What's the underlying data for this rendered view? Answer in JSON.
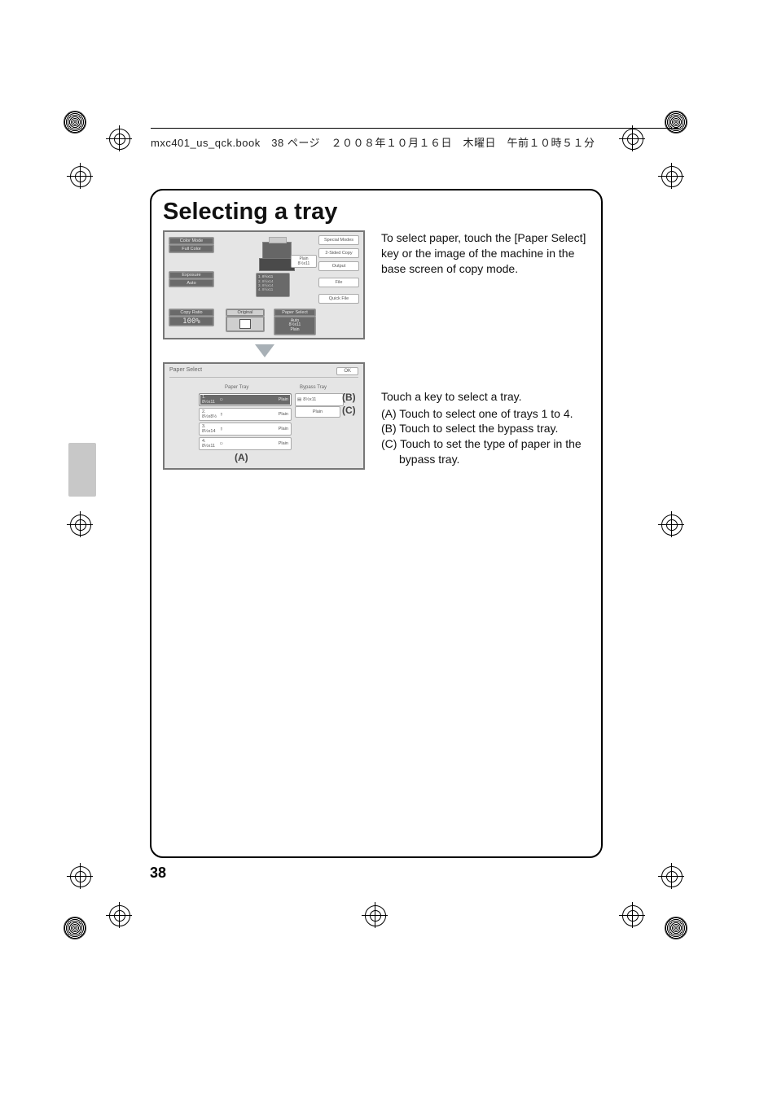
{
  "header": {
    "text": "mxc401_us_qck.book　38 ページ　２００８年１０月１６日　木曜日　午前１０時５１分"
  },
  "page_number": "38",
  "title": "Selecting a tray",
  "intro_text": "To select paper, touch the [Paper Select] key or the image of the machine in the base screen of copy mode.",
  "step2_heading": "Touch a key to select a tray.",
  "step2_a": "(A) Touch to select one of trays 1 to 4.",
  "step2_b": "(B) Touch to select the bypass tray.",
  "step2_c": "(C) Touch to set the type of paper in the bypass tray.",
  "device_screen": {
    "color_mode_label": "Color Mode",
    "color_mode_value": "Full Color",
    "exposure_label": "Exposure",
    "exposure_value": "Auto",
    "copy_ratio_label": "Copy Ratio",
    "copy_ratio_value": "100%",
    "original_label": "Original",
    "paper_select_label": "Paper Select",
    "paper_select_value1": "Auto",
    "paper_select_value2": "8½x11",
    "paper_select_value3": "Plain",
    "plain_label": "Plain",
    "plain_size": "8½x11",
    "right_buttons": {
      "special": "Special Modes",
      "two_sided": "2-Sided Copy",
      "output": "Output",
      "file": "File",
      "quick_file": "Quick File"
    },
    "tray_list": [
      {
        "n": "1.",
        "size": "8½x11"
      },
      {
        "n": "2.",
        "size": "8½x14"
      },
      {
        "n": "3.",
        "size": "8½x14"
      },
      {
        "n": "4.",
        "size": "8½x11"
      }
    ]
  },
  "tray_screen": {
    "title": "Paper Select",
    "ok": "OK",
    "paper_tray_label": "Paper Tray",
    "bypass_tray_label": "Bypass Tray",
    "rows": [
      {
        "num": "1. 8½x11",
        "type": "Plain",
        "selected": true
      },
      {
        "num": "2. 8½x8½",
        "type": "Plain",
        "selected": false
      },
      {
        "num": "3. 8½x14",
        "type": "Plain",
        "selected": false
      },
      {
        "num": "4. 8½x11",
        "type": "Plain",
        "selected": false
      }
    ],
    "bypass_size": "8½x11",
    "bypass_type": "Plain",
    "callout_a": "(A)",
    "callout_b": "(B)",
    "callout_c": "(C)"
  }
}
